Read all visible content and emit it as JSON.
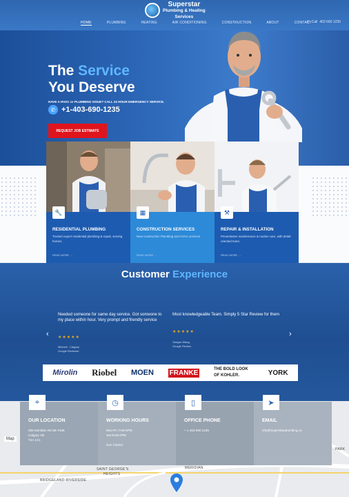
{
  "header": {
    "logo_line1": "Superstar",
    "logo_line2": "Plumbing & Heating",
    "logo_line3": "Services",
    "nav": [
      "HOME",
      "PLUMBING",
      "HEATING",
      "AIR CONDITIONING",
      "CONSTRUCTION",
      "ABOUT",
      "CONTACT"
    ],
    "call_label": "Call",
    "call_number": "403 690 1235"
  },
  "hero": {
    "title_pre": "The ",
    "title_highlight": "Service",
    "title_line2": "You Deserve",
    "subtitle": "HAVE A HVAC or PLUMBING ISSUE? CALL 24 HOUR EMERGENCY SERVICE.",
    "phone": "+1-403-690-1235",
    "cta": "REQUEST JOB ESTIMATE"
  },
  "services": [
    {
      "icon": "wrench-icon",
      "title": "RESIDENTIAL PLUMBING",
      "desc": "Trusted expert residential plumbing & repair, serving homes.",
      "more": "READ MORE  →"
    },
    {
      "icon": "building-icon",
      "title": "CONSTRUCTION SERVICES",
      "desc": "New construction Plumbing and HVAC services",
      "more": "READ MORE  →"
    },
    {
      "icon": "tools-icon",
      "title": "REPAIR & INSTALLATION",
      "desc": "Preventative maintenance & routine care, with detail-oriented team.",
      "more": "READ MORE  →"
    }
  ],
  "testimonials": {
    "title_pre": "Customer ",
    "title_highlight": "Experience",
    "items": [
      {
        "quote": "Needed someone for same day service. Got someone to my place within hour. Very prompt and friendly service",
        "stars": "★★★★★",
        "author": "Mitchell - Calgary",
        "source": "Google Reviewer"
      },
      {
        "quote": "Most knowledgeable Team. Simply 5 Star Review for them",
        "stars": "★★★★★",
        "author": "Xiaojun Wang",
        "source": "Google Review"
      }
    ],
    "prev": "‹",
    "next": "›"
  },
  "brands": [
    "Mirolin",
    "Riobel",
    "MOEN",
    "FRANKE",
    "THE BOLD LOOK OF KOHLER.",
    "YORK"
  ],
  "contact": [
    {
      "icon": "location-icon",
      "title": "OUR LOCATION",
      "lines": [
        "455 Meridian Rd SE #105",
        "Calgary AB",
        "T2A 1X1"
      ]
    },
    {
      "icon": "clock-icon",
      "title": "WORKING HOURS",
      "lines": [
        "Mon-Fri 7AM-9PM",
        "Sat 9AM-2PM",
        "",
        "Sun Closed"
      ]
    },
    {
      "icon": "phone-icon",
      "title": "OFFICE PHONE",
      "lines": [
        "+ 1 403 690 1235"
      ]
    },
    {
      "icon": "send-icon",
      "title": "EMAIL",
      "lines": [
        "info@SuperStarplumbing.ca"
      ]
    }
  ],
  "map": {
    "toggle": "Map",
    "roads": [
      "SAINT GEORGE'S",
      "HEIGHTS",
      "BRIDGELAND-RIVERSIDE",
      "MERIDIAN",
      "PARK"
    ]
  },
  "colors": {
    "primary": "#1d5bb0",
    "accent": "#2c8ad8",
    "highlight": "#5fb6ff",
    "cta": "#e0141d"
  }
}
